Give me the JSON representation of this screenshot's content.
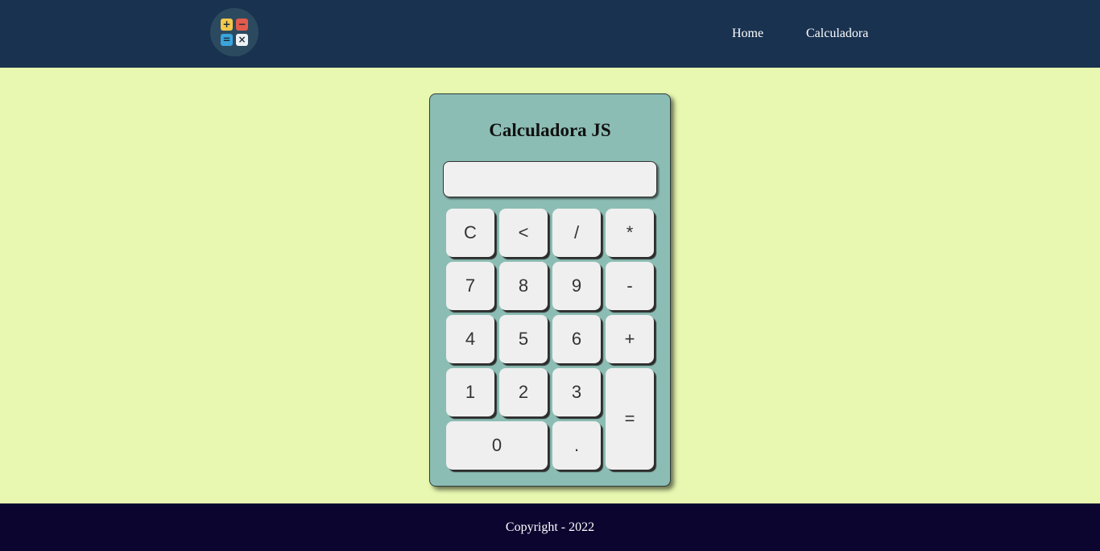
{
  "nav": {
    "links": [
      "Home",
      "Calculadora"
    ]
  },
  "logo": {
    "symbols": [
      "+",
      "−",
      "=",
      "×"
    ],
    "colors": [
      "#f3c84b",
      "#e25b4c",
      "#3aa4dc",
      "#eef1f3"
    ]
  },
  "calculator": {
    "title": "Calculadora JS",
    "display_value": "",
    "keys": {
      "clear": "C",
      "back": "<",
      "divide": "/",
      "multiply": "*",
      "seven": "7",
      "eight": "8",
      "nine": "9",
      "minus": "-",
      "four": "4",
      "five": "5",
      "six": "6",
      "plus": "+",
      "one": "1",
      "two": "2",
      "three": "3",
      "equals": "=",
      "zero": "0",
      "dot": "."
    }
  },
  "footer": {
    "copyright": "Copyright - 2022"
  },
  "colors": {
    "header_bg": "#193250",
    "page_bg": "#e8f8b0",
    "calculator_bg": "#8cbdb4",
    "key_bg": "#efefef",
    "footer_bg": "#0c0530"
  }
}
